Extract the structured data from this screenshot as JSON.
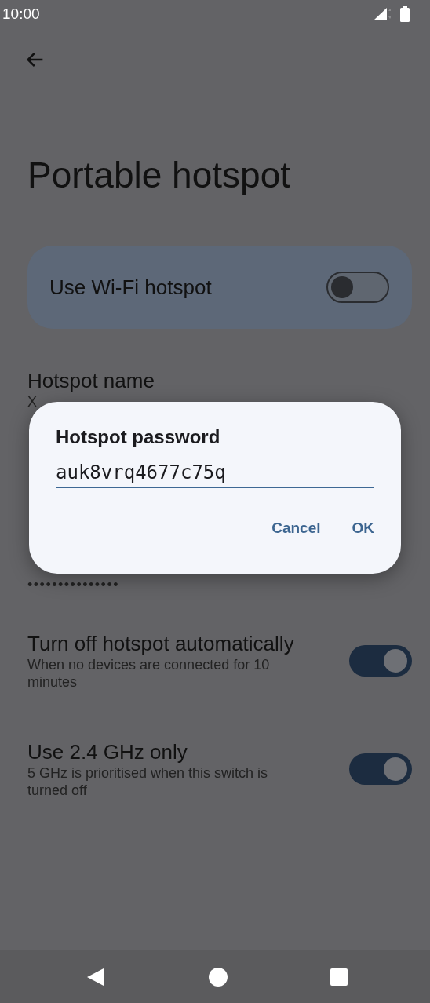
{
  "status_bar": {
    "time": "10:00"
  },
  "title": "Portable hotspot",
  "main_switch": {
    "label": "Use Wi-Fi hotspot",
    "on": false
  },
  "settings": [
    {
      "kind": "text",
      "title": "Hotspot name",
      "value": "X"
    },
    {
      "kind": "masked",
      "value": "•••••••••••••••"
    },
    {
      "kind": "switch",
      "title": "Turn off hotspot automatically",
      "summary": "When no devices are connected for 10 minutes",
      "on": true
    },
    {
      "kind": "switch",
      "title": "Use 2.4 GHz only",
      "summary": "5 GHz is prioritised when this switch is turned off",
      "on": true
    }
  ],
  "dialog": {
    "title": "Hotspot password",
    "value": "auk8vrq4677c75q",
    "buttons": [
      "Cancel",
      "OK"
    ]
  }
}
